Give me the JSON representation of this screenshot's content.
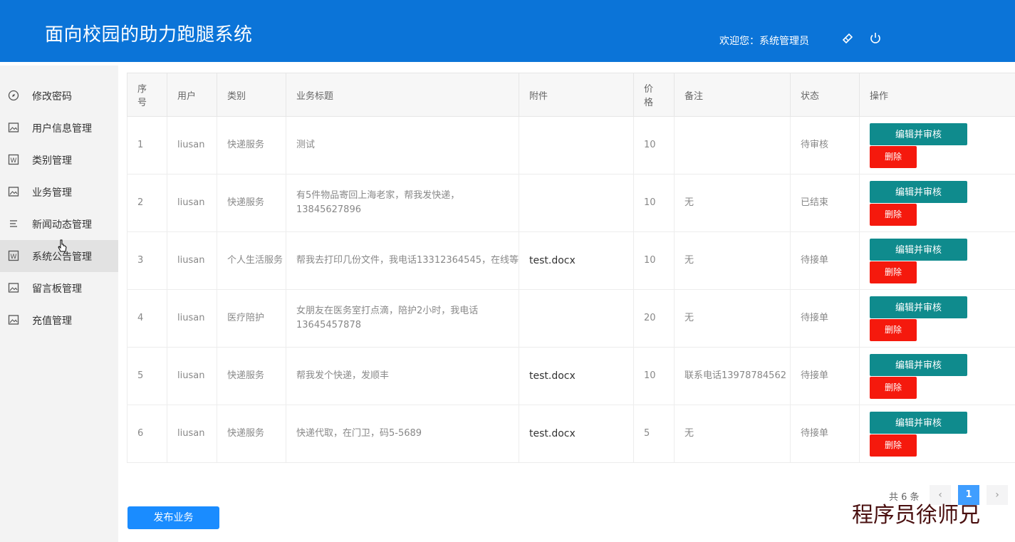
{
  "header": {
    "title": "面向校园的助力跑腿系统",
    "welcome": "欢迎您：系统管理员",
    "icons": [
      "skin-icon",
      "power-icon"
    ]
  },
  "sidebar": {
    "items": [
      {
        "label": "修改密码",
        "icon": "compass-icon"
      },
      {
        "label": "用户信息管理",
        "icon": "image-icon"
      },
      {
        "label": "类别管理",
        "icon": "word-icon"
      },
      {
        "label": "业务管理",
        "icon": "image-icon"
      },
      {
        "label": "新闻动态管理",
        "icon": "list-icon"
      },
      {
        "label": "系统公告管理",
        "icon": "word-icon",
        "active": true
      },
      {
        "label": "留言板管理",
        "icon": "image-icon"
      },
      {
        "label": "充值管理",
        "icon": "image-icon"
      }
    ]
  },
  "table": {
    "headers": [
      "序号",
      "用户",
      "类别",
      "业务标题",
      "附件",
      "价格",
      "备注",
      "状态",
      "操作"
    ],
    "rows": [
      {
        "no": "1",
        "user": "liusan",
        "category": "快递服务",
        "title": "测试",
        "file": "",
        "price": "10",
        "note": "",
        "status": "待审核"
      },
      {
        "no": "2",
        "user": "liusan",
        "category": "快递服务",
        "title": "有5件物品寄回上海老家，帮我发快递，13845627896",
        "file": "",
        "price": "10",
        "note": "无",
        "status": "已结束"
      },
      {
        "no": "3",
        "user": "liusan",
        "category": "个人生活服务",
        "title": "帮我去打印几份文件，我电话13312364545，在线等",
        "file": "test.docx",
        "price": "10",
        "note": "无",
        "status": "待接单"
      },
      {
        "no": "4",
        "user": "liusan",
        "category": "医疗陪护",
        "title": "女朋友在医务室打点滴，陪护2小时，我电话13645457878",
        "file": "",
        "price": "20",
        "note": "无",
        "status": "待接单"
      },
      {
        "no": "5",
        "user": "liusan",
        "category": "快递服务",
        "title": "帮我发个快递，发顺丰",
        "file": "test.docx",
        "price": "10",
        "note": "联系电话13978784562",
        "status": "待接单"
      },
      {
        "no": "6",
        "user": "liusan",
        "category": "快递服务",
        "title": "快递代取，在门卫，码5-5689",
        "file": "test.docx",
        "price": "5",
        "note": "无",
        "status": "待接单"
      }
    ],
    "edit_label": "编辑并审核",
    "delete_label": "删除"
  },
  "pager": {
    "total": "共 6 条",
    "prev": "‹",
    "current": "1",
    "next": "›"
  },
  "publish_label": "发布业务",
  "watermark": "程序员徐师兄",
  "colors": {
    "header": "#0b74d8",
    "edit": "#0f8b8d",
    "delete": "#f5190d",
    "publish": "#1a8cff",
    "pager_active": "#409eff"
  }
}
